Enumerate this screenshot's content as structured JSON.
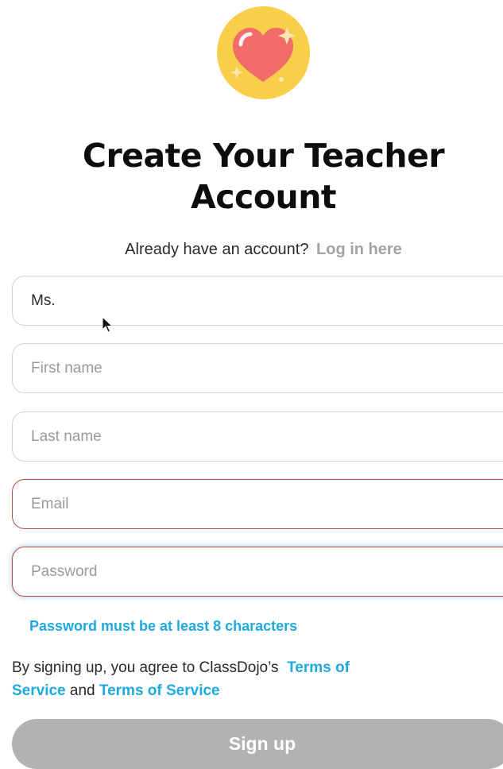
{
  "header": {
    "logo_icon": "heart-sparkle-icon",
    "title_line1": "Create Your Teacher",
    "title_line2": "Account",
    "login_prompt": "Already have an account?",
    "login_link": "Log in here"
  },
  "form": {
    "title_value": "Ms.",
    "first_name_placeholder": "First name",
    "last_name_placeholder": "Last name",
    "email_placeholder": "Email",
    "password_placeholder": "Password",
    "password_hint": "Password must be at least 8 characters"
  },
  "terms": {
    "prefix": "By signing up, you agree to ClassDojo’s",
    "link1_line1": "Terms of",
    "link1_line2": "Service",
    "middle": "and",
    "link2": "Terms of Service"
  },
  "actions": {
    "signup_label": "Sign up"
  },
  "colors": {
    "accent": "#1fa9e1",
    "logo_circle": "#f7cf49",
    "heart": "#f26b6b",
    "error_border": "#b24a4a",
    "disabled_button": "#b2b2b2"
  }
}
